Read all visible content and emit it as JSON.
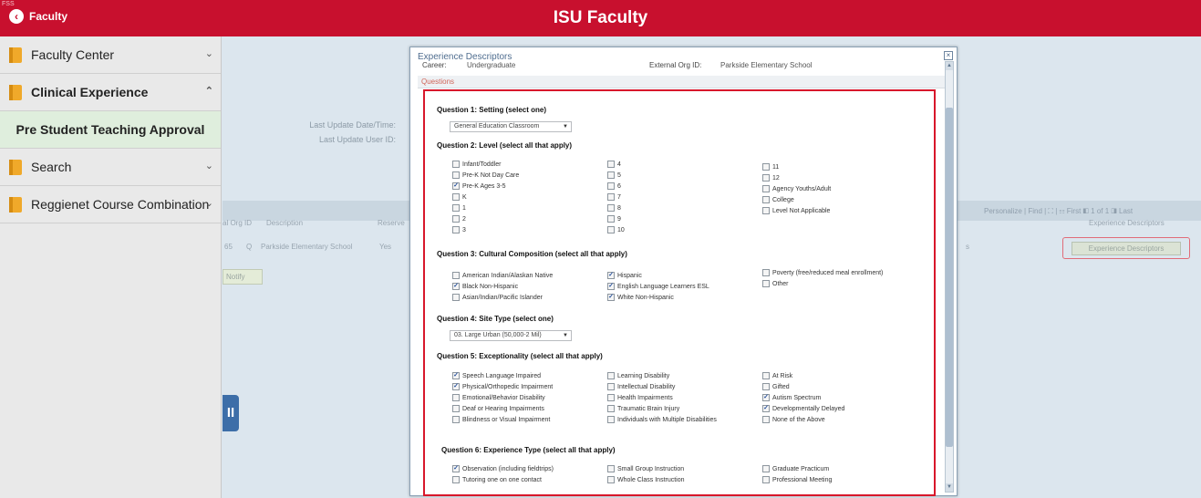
{
  "header": {
    "corner_tag": "FSS",
    "back_label": "Faculty",
    "title": "ISU Faculty"
  },
  "sidebar": {
    "items": [
      {
        "label": "Faculty Center",
        "chevron": "⌄"
      },
      {
        "label": "Clinical Experience",
        "chevron": "⌃"
      },
      {
        "label": "Pre Student Teaching Approval"
      },
      {
        "label": "Search",
        "chevron": "⌄"
      },
      {
        "label": "Reggienet Course Combination",
        "chevron": "⌄"
      }
    ]
  },
  "main": {
    "last_update_datetime_label": "Last Update Date/Time:",
    "last_update_user_label": "Last Update User ID:",
    "grid_nav": "Personalize | Find | ⛶ | ☷     First ◧ 1 of 1 ◨ Last",
    "grid_headers": [
      "al Org ID",
      "Description",
      "Reserve",
      "Experience Descriptors"
    ],
    "row": {
      "org_id": "65",
      "lookup_icon": "Q",
      "description": "Parkside Elementary School",
      "reserve": "Yes",
      "extra": "s"
    },
    "experience_button": "Experience Descriptors",
    "notify_button": "Notify",
    "pause_icon": "II"
  },
  "modal": {
    "title": "Experience Descriptors",
    "close_icon": "×",
    "career_label": "Career:",
    "career_value": "Undergraduate",
    "ext_org_label": "External Org ID:",
    "ext_org_value": "Parkside Elementary School",
    "tab_label": "Questions",
    "q1": {
      "heading": "Question 1: Setting (select one)",
      "selected": "General Education Classroom"
    },
    "q2": {
      "heading": "Question 2: Level (select all that apply)",
      "options": [
        {
          "label": "Infant/Toddler",
          "checked": false
        },
        {
          "label": "Pre-K Not Day Care",
          "checked": false
        },
        {
          "label": "Pre-K Ages 3-5",
          "checked": true
        },
        {
          "label": "K",
          "checked": false
        },
        {
          "label": "1",
          "checked": false
        },
        {
          "label": "2",
          "checked": false
        },
        {
          "label": "3",
          "checked": false
        },
        {
          "label": "4",
          "checked": false
        },
        {
          "label": "5",
          "checked": false
        },
        {
          "label": "6",
          "checked": false
        },
        {
          "label": "7",
          "checked": false
        },
        {
          "label": "8",
          "checked": false
        },
        {
          "label": "9",
          "checked": false
        },
        {
          "label": "10",
          "checked": false
        },
        {
          "label": "11",
          "checked": false
        },
        {
          "label": "12",
          "checked": false
        },
        {
          "label": "Agency Youths/Adult",
          "checked": false
        },
        {
          "label": "College",
          "checked": false
        },
        {
          "label": "Level Not Applicable",
          "checked": false
        }
      ]
    },
    "q3": {
      "heading": "Question 3: Cultural Composition (select all that apply)",
      "options": [
        {
          "label": "American Indian/Alaskan Native",
          "checked": false
        },
        {
          "label": "Black Non-Hispanic",
          "checked": true
        },
        {
          "label": "Asian/Indian/Pacific Islander",
          "checked": false
        },
        {
          "label": "Hispanic",
          "checked": true
        },
        {
          "label": "English Language Learners ESL",
          "checked": true
        },
        {
          "label": "White Non-Hispanic",
          "checked": true
        },
        {
          "label": "Poverty (free/reduced meal enrollment)",
          "checked": false
        },
        {
          "label": "Other",
          "checked": false
        }
      ]
    },
    "q4": {
      "heading": "Question 4: Site Type (select one)",
      "selected": "03. Large Urban (50,000-2 Mil)"
    },
    "q5": {
      "heading": "Question 5: Exceptionality (select all that apply)",
      "options": [
        {
          "label": "Speech Language Impaired",
          "checked": true
        },
        {
          "label": "Physical/Orthopedic Impairment",
          "checked": true
        },
        {
          "label": "Emotional/Behavior Disability",
          "checked": false
        },
        {
          "label": "Deaf or Hearing Impairments",
          "checked": false
        },
        {
          "label": "Blindness or Visual Impairment",
          "checked": false
        },
        {
          "label": "Learning Disability",
          "checked": false
        },
        {
          "label": "Intellectual Disability",
          "checked": false
        },
        {
          "label": "Health Impairments",
          "checked": false
        },
        {
          "label": "Traumatic Brain Injury",
          "checked": false
        },
        {
          "label": "Individuals with Multiple Disabilities",
          "checked": false
        },
        {
          "label": "At Risk",
          "checked": false
        },
        {
          "label": "Gifted",
          "checked": false
        },
        {
          "label": "Autism Spectrum",
          "checked": true
        },
        {
          "label": "Developmentally Delayed",
          "checked": true
        },
        {
          "label": "None of the Above",
          "checked": false
        }
      ]
    },
    "q6": {
      "heading": "Question 6: Experience Type (select all that apply)",
      "options": [
        {
          "label": "Observation (including fieldtrips)",
          "checked": true
        },
        {
          "label": "Tutoring one on one contact",
          "checked": false
        },
        {
          "label": "Small Group Instruction",
          "checked": false
        },
        {
          "label": "Whole Class Instruction",
          "checked": false
        },
        {
          "label": "Graduate Practicum",
          "checked": false
        },
        {
          "label": "Professional Meeting",
          "checked": false
        }
      ]
    }
  },
  "colors": {
    "brand_red": "#c8102e",
    "highlight_red": "#d8172b",
    "active_nav": "#dfeedd",
    "check": "#27509b"
  }
}
